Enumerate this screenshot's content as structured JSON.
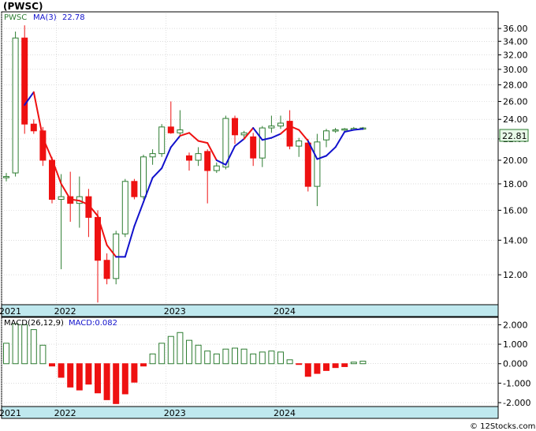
{
  "ticker_title": "(PWSC)",
  "legend": {
    "symbol": "PWSC",
    "ma_label": "MA(3)",
    "ma_value": "22.78",
    "macd_label": "MACD(26,12,9)",
    "macd_value_label": "MACD:0.082"
  },
  "last_price_label": "22.81",
  "watermark": "© 12Stocks.com",
  "colors": {
    "up": "#2e7d32",
    "down": "#ee1111",
    "ma_red": "#ee1111",
    "ma_blue": "#1111cc",
    "axis_strip": "#bfe8ee",
    "grid": "#c8c8c8",
    "price_badge_bg": "#e8f8e8",
    "price_badge_border": "#2e7d32"
  },
  "chart_data": [
    {
      "type": "candlestick",
      "title": "(PWSC)",
      "x_labels": [
        "2021",
        "2022",
        "2023",
        "2024"
      ],
      "x_label_index": [
        0,
        6,
        18,
        30
      ],
      "y_ticks": [
        12,
        14,
        16,
        18,
        20,
        22,
        24,
        26,
        28,
        30,
        32,
        34,
        36
      ],
      "y_tick_labels": [
        "12.00",
        "14.00",
        "16.00",
        "18.00",
        "20.00",
        "22.00",
        "24.00",
        "26.00",
        "28.00",
        "30.00",
        "32.00",
        "34.00",
        "36.00"
      ],
      "ylim": [
        10.5,
        38.5
      ],
      "y_scale": "log",
      "candles": [
        {
          "o": 18.5,
          "h": 18.9,
          "l": 18.2,
          "c": 18.6
        },
        {
          "o": 18.9,
          "h": 35.5,
          "l": 18.6,
          "c": 34.5
        },
        {
          "o": 34.5,
          "h": 36.5,
          "l": 22.5,
          "c": 23.5
        },
        {
          "o": 23.5,
          "h": 24.0,
          "l": 22.5,
          "c": 22.8
        },
        {
          "o": 22.8,
          "h": 23.2,
          "l": 19.5,
          "c": 20.0
        },
        {
          "o": 20.0,
          "h": 20.3,
          "l": 16.5,
          "c": 16.8
        },
        {
          "o": 16.8,
          "h": 18.8,
          "l": 12.3,
          "c": 17.0
        },
        {
          "o": 17.0,
          "h": 19.0,
          "l": 15.2,
          "c": 16.5
        },
        {
          "o": 16.5,
          "h": 18.6,
          "l": 14.8,
          "c": 17.0
        },
        {
          "o": 17.0,
          "h": 17.6,
          "l": 14.2,
          "c": 15.5
        },
        {
          "o": 15.5,
          "h": 16.0,
          "l": 10.6,
          "c": 12.8
        },
        {
          "o": 12.8,
          "h": 13.2,
          "l": 11.5,
          "c": 11.8
        },
        {
          "o": 11.8,
          "h": 14.6,
          "l": 11.5,
          "c": 14.4
        },
        {
          "o": 14.4,
          "h": 18.4,
          "l": 14.2,
          "c": 18.2
        },
        {
          "o": 18.2,
          "h": 18.4,
          "l": 16.8,
          "c": 17.0
        },
        {
          "o": 17.0,
          "h": 20.5,
          "l": 16.8,
          "c": 20.3
        },
        {
          "o": 20.3,
          "h": 21.0,
          "l": 19.6,
          "c": 20.6
        },
        {
          "o": 20.6,
          "h": 23.5,
          "l": 20.3,
          "c": 23.2
        },
        {
          "o": 23.2,
          "h": 26.0,
          "l": 22.5,
          "c": 22.6
        },
        {
          "o": 22.6,
          "h": 25.0,
          "l": 22.3,
          "c": 22.9
        },
        {
          "o": 20.4,
          "h": 20.7,
          "l": 19.1,
          "c": 20.0
        },
        {
          "o": 20.0,
          "h": 21.2,
          "l": 19.5,
          "c": 20.6
        },
        {
          "o": 20.8,
          "h": 21.0,
          "l": 16.5,
          "c": 19.1
        },
        {
          "o": 19.1,
          "h": 19.8,
          "l": 18.9,
          "c": 19.5
        },
        {
          "o": 19.4,
          "h": 24.4,
          "l": 19.2,
          "c": 24.1
        },
        {
          "o": 24.1,
          "h": 24.4,
          "l": 21.5,
          "c": 22.4
        },
        {
          "o": 22.4,
          "h": 22.8,
          "l": 22.1,
          "c": 22.6
        },
        {
          "o": 22.2,
          "h": 22.6,
          "l": 19.5,
          "c": 20.2
        },
        {
          "o": 20.2,
          "h": 23.3,
          "l": 19.4,
          "c": 23.1
        },
        {
          "o": 23.1,
          "h": 24.4,
          "l": 22.6,
          "c": 23.3
        },
        {
          "o": 23.3,
          "h": 24.4,
          "l": 23.0,
          "c": 23.6
        },
        {
          "o": 23.8,
          "h": 25.0,
          "l": 21.0,
          "c": 21.3
        },
        {
          "o": 21.3,
          "h": 22.1,
          "l": 20.3,
          "c": 21.8
        },
        {
          "o": 21.6,
          "h": 22.0,
          "l": 17.4,
          "c": 17.8
        },
        {
          "o": 17.8,
          "h": 22.5,
          "l": 16.3,
          "c": 21.7
        },
        {
          "o": 21.9,
          "h": 23.0,
          "l": 21.2,
          "c": 22.8
        },
        {
          "o": 22.8,
          "h": 23.1,
          "l": 22.6,
          "c": 22.9
        },
        {
          "o": 22.9,
          "h": 23.1,
          "l": 22.8,
          "c": 23.0
        },
        {
          "o": 23.0,
          "h": 23.2,
          "l": 22.9,
          "c": 23.05
        },
        {
          "o": 23.0,
          "h": 23.2,
          "l": 22.9,
          "c": 23.1
        }
      ],
      "ma_series": {
        "name": "MA(3)",
        "start_index": 2,
        "values": [
          25.6,
          27.1,
          22.1,
          20.1,
          18.0,
          16.8,
          16.7,
          16.4,
          15.6,
          13.7,
          13.0,
          13.0,
          14.9,
          16.6,
          18.5,
          19.3,
          21.2,
          22.3,
          22.6,
          21.8,
          21.6,
          20.0,
          19.6,
          21.3,
          22.0,
          23.1,
          21.9,
          22.1,
          22.5,
          23.3,
          22.9,
          21.8,
          20.1,
          20.4,
          21.2,
          22.7,
          22.9,
          23.0
        ]
      }
    },
    {
      "type": "bar",
      "title": "MACD(26,12,9)",
      "x_labels": [
        "2021",
        "2022",
        "2023",
        "2024"
      ],
      "x_label_index": [
        0,
        6,
        18,
        30
      ],
      "y_ticks": [
        -2,
        -1,
        0,
        1,
        2
      ],
      "y_tick_labels": [
        "-2.000",
        "-1.000",
        "0.000",
        "1.000",
        "2.000"
      ],
      "ylim": [
        -2.2,
        2.3
      ],
      "values": [
        1.05,
        2.05,
        2.0,
        1.75,
        0.95,
        -0.12,
        -0.7,
        -1.2,
        -1.35,
        -1.05,
        -1.5,
        -1.85,
        -2.05,
        -1.55,
        -0.95,
        -0.12,
        0.5,
        1.05,
        1.4,
        1.6,
        1.2,
        0.95,
        0.65,
        0.5,
        0.75,
        0.8,
        0.75,
        0.5,
        0.6,
        0.65,
        0.6,
        0.2,
        -0.02,
        -0.65,
        -0.5,
        -0.35,
        -0.2,
        -0.15,
        0.08,
        0.13
      ]
    }
  ]
}
